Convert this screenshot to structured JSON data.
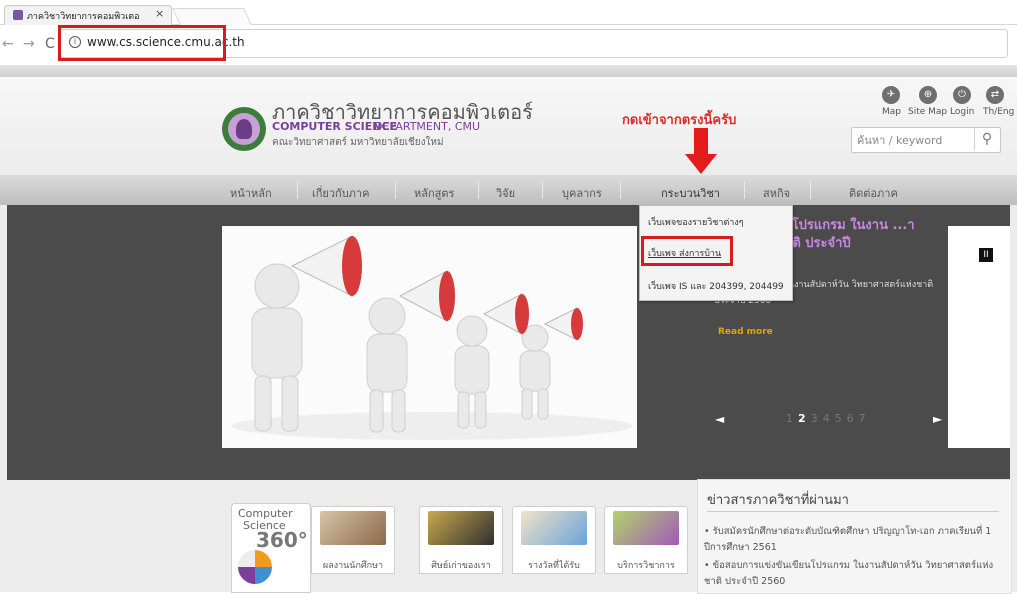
{
  "browser": {
    "tab_title": "ภาควิชาวิทยาการคอมพิวเตอ",
    "tab_close": "×",
    "url": "www.cs.science.cmu.ac.th",
    "back": "←",
    "forward": "→",
    "reload": "C"
  },
  "header": {
    "title_th": "ภาควิชาวิทยาการคอมพิวเตอร์",
    "title_en_bold": "COMPUTER SCIENCE",
    "title_en_rest": "DEPARTMENT, CMU",
    "faculty": "คณะวิทยาศาสตร์ มหาวิทยาลัยเชียงใหม่",
    "annotation": "กดเข้าจากตรงนี้ครับ",
    "utilities": [
      "Map",
      "Site Map",
      "Login",
      "Th/Eng"
    ],
    "search_placeholder": "ค้นหา / keyword"
  },
  "nav": {
    "items": [
      "หน้าหลัก",
      "เกี่ยวกับภาค",
      "หลักสูตร",
      "วิจัย",
      "บุคลากร",
      "กระบวนวิชา",
      "สหกิจ",
      "ติดต่อภาค"
    ]
  },
  "dropdown": {
    "items": [
      "เว็บเพจของรายวิชาต่างๆ",
      "เว็บเพจ ส่งการบ้าน",
      "เว็บเพจ IS และ 204399, 204499"
    ]
  },
  "slider": {
    "caption_title": "...ขงขันเขียนโปรแกรม ในงาน ...าศาสตร์แห่งชาติ ประจำปี",
    "caption_body": "...เขียนโปรแกรม ในงานสัปดาห์วัน วิทยาศาสตร์แห่งชาติ ประจำปี 2560",
    "read_more": "Read more",
    "pages": [
      "1",
      "2",
      "3",
      "4",
      "5",
      "6",
      "7"
    ],
    "active_page": "2",
    "prev": "◄",
    "next": "►",
    "pause": "II"
  },
  "tiles": {
    "cs360_line1": "Computer",
    "cs360_line2": "Science",
    "cs360_number": "360°",
    "labels": [
      "ผลงานนักศึกษา",
      "ศิษย์เก่าของเรา",
      "รางวัลที่ได้รับ",
      "บริการวิชาการ"
    ]
  },
  "news": {
    "title": "ข่าวสารภาควิชาที่ผ่านมา",
    "items": [
      "รับสมัครนักศึกษาต่อระดับบัณฑิตศึกษา ปริญญาโท-เอก ภาคเรียนที่ 1 ปีการศึกษา 2561",
      "ข้อสอบการแข่งขันเขียนโปรแกรม ในงานสัปดาห์วัน วิทยาศาสตร์แห่งชาติ ประจำปี 2560"
    ]
  },
  "colors": {
    "brand_purple": "#7b3e9a",
    "annotation_red": "#e32b2b",
    "caption_purple": "#c985e6",
    "read_more": "#e2a400"
  }
}
